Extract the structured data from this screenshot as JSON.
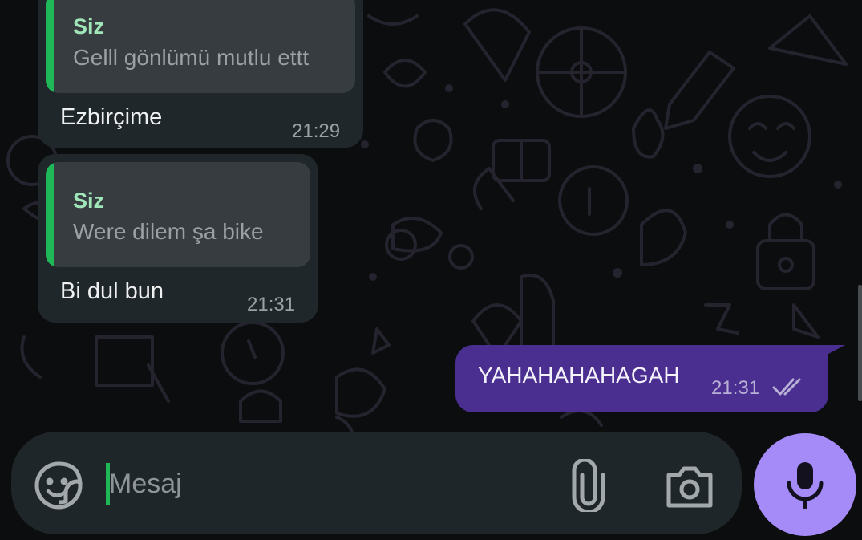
{
  "theme": {
    "incoming_bubble": "#1f272a",
    "quote_background": "#363c3f",
    "quote_accent": "#1fb758",
    "outgoing_bubble": "#4a2f91",
    "mic_button": "#a58bf8"
  },
  "messages": [
    {
      "direction": "incoming",
      "reply_to": {
        "author": "Siz",
        "text": "Gelll gönlümü mutlu ettt"
      },
      "text": "Ezbirçime",
      "time": "21:29"
    },
    {
      "direction": "incoming",
      "reply_to": {
        "author": "Siz",
        "text": "Were dilem şa bike"
      },
      "text": "Bi dul bun",
      "time": "21:31"
    },
    {
      "direction": "outgoing",
      "text": "YAHAHAHAHAGAH",
      "time": "21:31",
      "status_icon": "double-check-icon"
    }
  ],
  "composer": {
    "placeholder": "Mesaj",
    "value": "",
    "icons": {
      "emoji": "sticker-icon",
      "attach": "paperclip-icon",
      "camera": "camera-icon",
      "send": "microphone-icon"
    }
  }
}
